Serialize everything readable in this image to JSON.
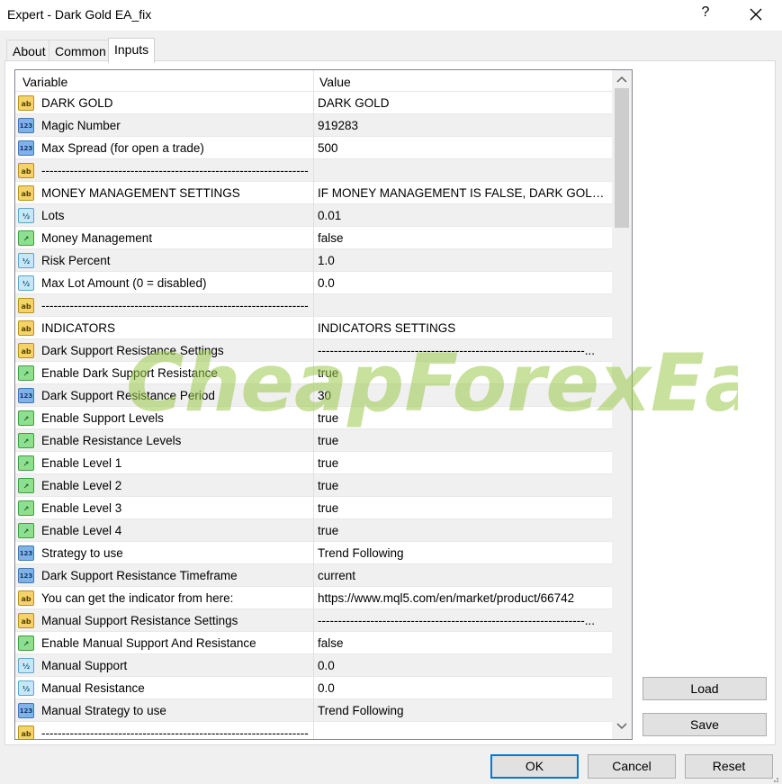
{
  "window": {
    "title": "Expert - Dark Gold EA_fix",
    "help_label": "?"
  },
  "tabs": [
    {
      "label": "About"
    },
    {
      "label": "Common"
    },
    {
      "label": "Inputs"
    }
  ],
  "grid": {
    "col_variable": "Variable",
    "col_value": "Value",
    "rows": [
      {
        "type": "ab",
        "variable": "DARK GOLD",
        "value": "DARK GOLD"
      },
      {
        "type": "num",
        "variable": "Magic Number",
        "value": "919283"
      },
      {
        "type": "num",
        "variable": "Max Spread (for open a trade)",
        "value": "500"
      },
      {
        "type": "ab",
        "variable": "------------------------------------------------------------------",
        "value": ""
      },
      {
        "type": "ab",
        "variable": "MONEY MANAGEMENT SETTINGS",
        "value": "IF MONEY MANAGEMENT IS FALSE, DARK GOLD ..."
      },
      {
        "type": "frac",
        "variable": "Lots",
        "value": "0.01"
      },
      {
        "type": "bool",
        "variable": "Money Management",
        "value": "false"
      },
      {
        "type": "frac",
        "variable": "Risk Percent",
        "value": "1.0"
      },
      {
        "type": "frac",
        "variable": "Max Lot Amount (0 = disabled)",
        "value": "0.0"
      },
      {
        "type": "ab",
        "variable": "------------------------------------------------------------------",
        "value": ""
      },
      {
        "type": "ab",
        "variable": "INDICATORS",
        "value": "INDICATORS SETTINGS"
      },
      {
        "type": "ab",
        "variable": "Dark Support Resistance Settings",
        "value": "------------------------------------------------------------------..."
      },
      {
        "type": "bool",
        "variable": "Enable Dark Support Resistance",
        "value": "true"
      },
      {
        "type": "num",
        "variable": "Dark Support Resistance Period",
        "value": "30"
      },
      {
        "type": "bool",
        "variable": "Enable Support Levels",
        "value": "true"
      },
      {
        "type": "bool",
        "variable": "Enable Resistance Levels",
        "value": "true"
      },
      {
        "type": "bool",
        "variable": "Enable Level 1",
        "value": "true"
      },
      {
        "type": "bool",
        "variable": "Enable Level 2",
        "value": "true"
      },
      {
        "type": "bool",
        "variable": "Enable Level 3",
        "value": "true"
      },
      {
        "type": "bool",
        "variable": "Enable Level 4",
        "value": "true"
      },
      {
        "type": "num",
        "variable": "Strategy to use",
        "value": "Trend Following"
      },
      {
        "type": "num",
        "variable": "Dark Support Resistance Timeframe",
        "value": "current"
      },
      {
        "type": "ab",
        "variable": "You can get the indicator from here:",
        "value": "https://www.mql5.com/en/market/product/66742"
      },
      {
        "type": "ab",
        "variable": "Manual Support Resistance Settings",
        "value": "------------------------------------------------------------------..."
      },
      {
        "type": "bool",
        "variable": "Enable Manual Support And Resistance",
        "value": "false"
      },
      {
        "type": "frac",
        "variable": "Manual Support",
        "value": "0.0"
      },
      {
        "type": "frac",
        "variable": "Manual Resistance",
        "value": "0.0"
      },
      {
        "type": "num",
        "variable": "Manual Strategy to use",
        "value": "Trend Following"
      },
      {
        "type": "ab",
        "variable": "------------------------------------------------------------------",
        "value": ""
      }
    ]
  },
  "icons": {
    "ab": "ab",
    "num": "123",
    "frac": "½",
    "bool": "↗"
  },
  "side_buttons": {
    "load": "Load",
    "save": "Save"
  },
  "buttons": {
    "ok": "OK",
    "cancel": "Cancel",
    "reset": "Reset"
  },
  "watermark": {
    "text": "CheapForexEa",
    "color": "#9bc84a"
  }
}
